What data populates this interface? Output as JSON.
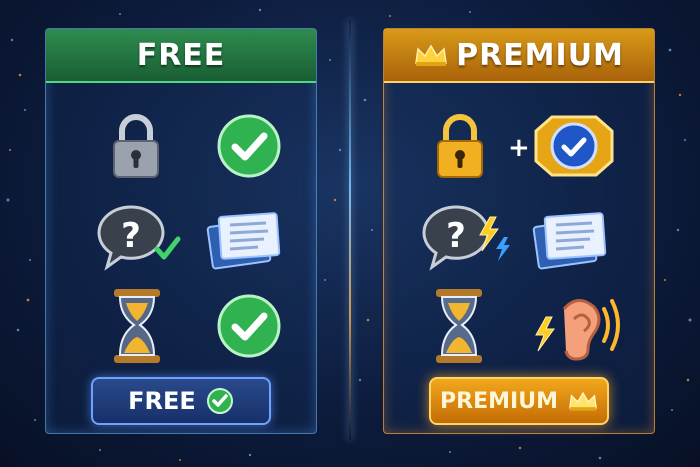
{
  "free": {
    "title": "FREE",
    "button_label": "FREE",
    "accent": "#2fa84f",
    "rows": [
      {
        "left_icon": "padlock-icon",
        "right_icon": "check-icon"
      },
      {
        "left_icon": "question-bubble-icon",
        "right_icon": "documents-icon"
      },
      {
        "left_icon": "hourglass-icon",
        "right_icon": "check-icon"
      }
    ]
  },
  "premium": {
    "title": "PREMIUM",
    "button_label": "PREMIUM",
    "accent": "#e89a14",
    "plus_symbol": "+",
    "rows": [
      {
        "left_icon": "gold-padlock-icon",
        "right_icon": "verified-badge-icon"
      },
      {
        "left_icon": "question-lightning-icon",
        "right_icon": "documents-icon"
      },
      {
        "left_icon": "hourglass-icon",
        "right_icon": "ear-sound-icon"
      }
    ]
  }
}
